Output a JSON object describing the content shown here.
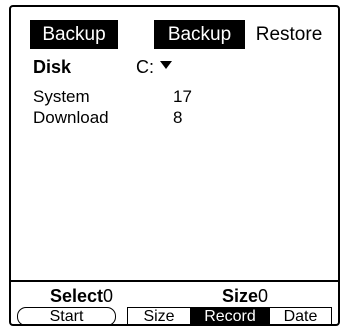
{
  "header": {
    "title": "Backup"
  },
  "tabs": [
    {
      "label": "Backup",
      "selected": true
    },
    {
      "label": "Restore",
      "selected": false
    }
  ],
  "disk": {
    "label": "Disk",
    "value": "C:",
    "dropdown_icon": "triangle-down-icon"
  },
  "items": [
    {
      "name": "System",
      "count": "17"
    },
    {
      "name": "Download",
      "count": "8"
    }
  ],
  "footer": {
    "select_label": "Select",
    "select_value": "0",
    "size_label": "Size",
    "size_value": "0"
  },
  "buttons": {
    "start": "Start",
    "sort": [
      {
        "label": "Size",
        "selected": false
      },
      {
        "label": "Record",
        "selected": true
      },
      {
        "label": "Date",
        "selected": false
      }
    ]
  },
  "colors": {
    "foreground": "#000000",
    "background": "#ffffff",
    "selected": "#000000"
  }
}
